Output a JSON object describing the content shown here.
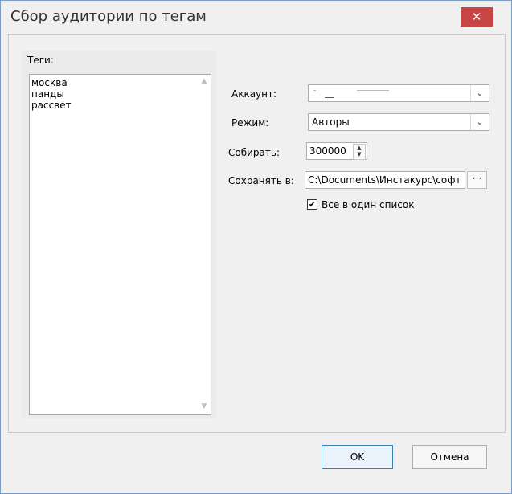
{
  "window": {
    "title": "Сбор аудитории по тегам",
    "close_glyph": "✕"
  },
  "tags": {
    "label": "Теги:",
    "value": "москва\nпанды\nрассвет",
    "scroll_up_glyph": "▲",
    "scroll_down_glyph": "▼"
  },
  "form": {
    "account_label": "Аккаунт:",
    "account_value": "",
    "mode_label": "Режим:",
    "mode_value": "Авторы",
    "collect_label": "Собирать:",
    "collect_value": "300000",
    "save_label": "Сохранять в:",
    "save_path": "C:\\Documents\\Инстакурс\\софт",
    "browse_label": "···",
    "single_list_label": "Все в один список",
    "single_list_checked": true,
    "dropdown_glyph": "⌄",
    "spin_up": "▲",
    "spin_down": "▼",
    "check_glyph": "✔"
  },
  "buttons": {
    "ok": "OK",
    "cancel": "Отмена"
  }
}
